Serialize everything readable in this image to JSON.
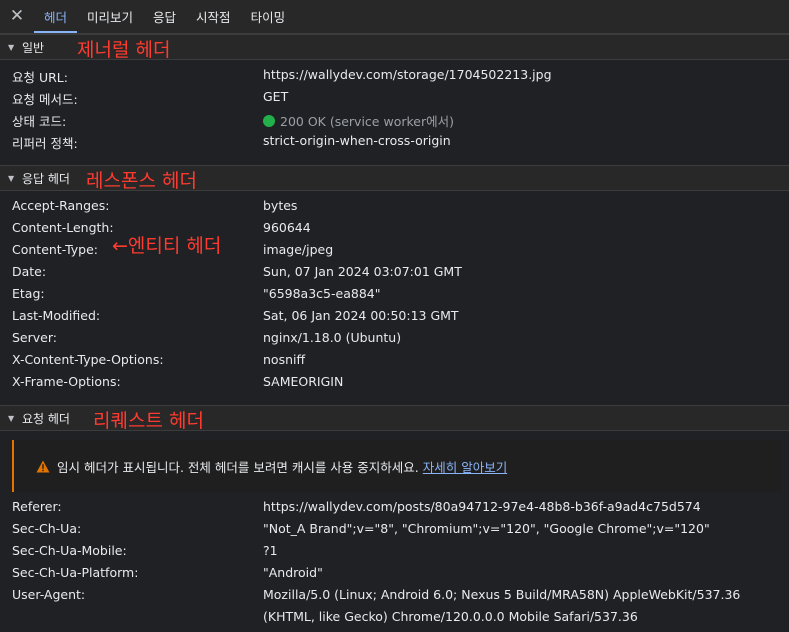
{
  "tabs": [
    "헤더",
    "미리보기",
    "응답",
    "시작점",
    "타이밍"
  ],
  "sections": {
    "general": {
      "title": "일반",
      "annotation": "제너럴 헤더",
      "rows": [
        {
          "key": "요청 URL:",
          "value": "https://wallydev.com/storage/1704502213.jpg"
        },
        {
          "key": "요청 메서드:",
          "value": "GET"
        },
        {
          "key": "상태 코드:",
          "value": "200 OK (service worker에서)"
        },
        {
          "key": "리퍼러 정책:",
          "value": "strict-origin-when-cross-origin"
        }
      ]
    },
    "response": {
      "title": "응답 헤더",
      "annotation": "레스폰스 헤더",
      "entity_annotation": "←엔티티 헤더",
      "rows": [
        {
          "key": "Accept-Ranges:",
          "value": "bytes"
        },
        {
          "key": "Content-Length:",
          "value": "960644"
        },
        {
          "key": "Content-Type:",
          "value": "image/jpeg"
        },
        {
          "key": "Date:",
          "value": "Sun, 07 Jan 2024 03:07:01 GMT"
        },
        {
          "key": "Etag:",
          "value": "\"6598a3c5-ea884\""
        },
        {
          "key": "Last-Modified:",
          "value": "Sat, 06 Jan 2024 00:50:13 GMT"
        },
        {
          "key": "Server:",
          "value": "nginx/1.18.0 (Ubuntu)"
        },
        {
          "key": "X-Content-Type-Options:",
          "value": "nosniff"
        },
        {
          "key": "X-Frame-Options:",
          "value": "SAMEORIGIN"
        }
      ]
    },
    "request": {
      "title": "요청 헤더",
      "annotation": "리퀘스트 헤더",
      "warning": "임시 헤더가 표시됩니다. 전체 헤더를 보려면 캐시를 사용 중지하세요.",
      "warning_link": "자세히 알아보기",
      "rows": [
        {
          "key": "Referer:",
          "value": "https://wallydev.com/posts/80a94712-97e4-48b8-b36f-a9ad4c75d574"
        },
        {
          "key": "Sec-Ch-Ua:",
          "value": "\"Not_A Brand\";v=\"8\", \"Chromium\";v=\"120\", \"Google Chrome\";v=\"120\""
        },
        {
          "key": "Sec-Ch-Ua-Mobile:",
          "value": "?1"
        },
        {
          "key": "Sec-Ch-Ua-Platform:",
          "value": "\"Android\""
        },
        {
          "key": "User-Agent:",
          "value": "Mozilla/5.0 (Linux; Android 6.0; Nexus 5 Build/MRA58N) AppleWebKit/537.36 (KHTML, like Gecko) Chrome/120.0.0.0 Mobile Safari/537.36"
        }
      ]
    }
  },
  "icons": {
    "close": "close-icon",
    "collapse": "triangle-down-icon",
    "status": "status-dot-icon",
    "warning": "warning-icon"
  },
  "colors": {
    "accent": "#8ab4f8",
    "annotation": "#ff3b30",
    "status_ok": "#23b04b",
    "warning": "#e37400"
  }
}
